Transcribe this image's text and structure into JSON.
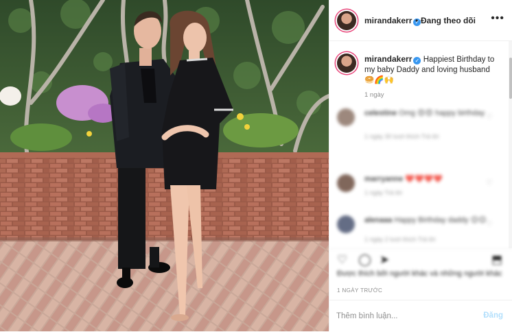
{
  "post": {
    "username": "mirandakerr",
    "follow_status": "Đang theo dõi",
    "separator": "•",
    "more": "•••",
    "verified_mark": "✓",
    "avatar_icon": "profile-avatar",
    "caption_username": "mirandakerr",
    "caption_text": "Happiest Birthday to my baby Daddy and loving husband",
    "caption_emoji": "🥯🌈🙌",
    "caption_time": "1 ngày",
    "posted_ago": "1 NGÀY TRƯỚC",
    "add_comment_placeholder": "Thêm bình luận...",
    "post_button": "Đăng",
    "likes_text": "Được thích bởi người khác và những người khác"
  },
  "comments": [
    {
      "user": "celestine",
      "text": "Omg 😍😍 happy birthday",
      "meta": "1 ngày  30 lượt thích  Trả lời"
    },
    {
      "user": "marryanne",
      "text": "❤️❤️❤️❤️",
      "meta": "1 ngày  Trả lời"
    },
    {
      "user": "alenaaa",
      "text": "Happy Birthday daddy 😊😊",
      "meta": "1 ngày  2 lượt thích  Trả lời"
    }
  ],
  "icons": {
    "heart": "♡",
    "like": "heart-icon",
    "comment": "comment-icon",
    "share": "share-icon",
    "save": "bookmark-icon"
  },
  "colors": {
    "accent": "#3897f0",
    "story_ring": "#e8457a",
    "post_disabled": "#b2dffc"
  }
}
